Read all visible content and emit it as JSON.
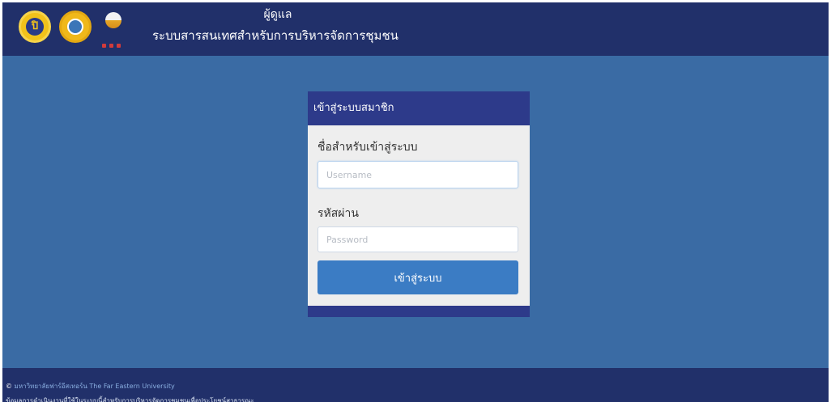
{
  "header": {
    "role": "ผู้ดูแล",
    "title": "ระบบสารสนเทศสำหรับการบริหารจัดการชุมชน",
    "logo1_icon": "university-seal-icon",
    "logo2_icon": "emblem-icon",
    "logo3_icon": "community-logo-icon"
  },
  "login": {
    "panel_title": "เข้าสู่ระบบสมาชิก",
    "username_label": "ชื่อสำหรับเข้าสู่ระบบ",
    "username_placeholder": "Username",
    "password_label": "รหัสผ่าน",
    "password_placeholder": "Password",
    "submit_label": "เข้าสู่ระบบ"
  },
  "footer": {
    "copyright_symbol": "©",
    "university_th": "มหาวิทยาลัยฟาร์อีสเทอร์น",
    "university_en": "The Far Eastern University",
    "note": "ข้อมูลการดำเนินงานที่ใช้ในระบบนี้สำหรับการบริหารจัดการชุมชนเพื่อประโยชน์สาธารณะ"
  },
  "colors": {
    "header_bg": "#21306a",
    "page_bg": "#3a6ba4",
    "panel_head": "#2d3a8a",
    "button": "#3b7cc4"
  }
}
